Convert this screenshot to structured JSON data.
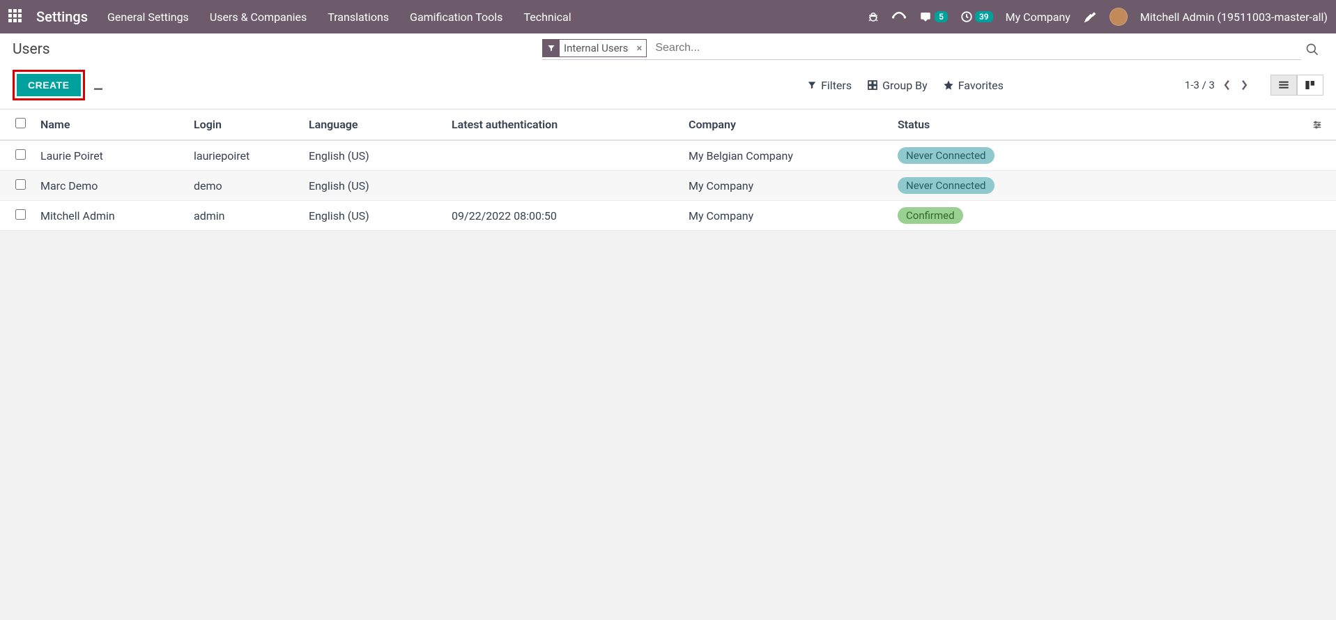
{
  "topbar": {
    "app_title": "Settings",
    "menu": [
      "General Settings",
      "Users & Companies",
      "Translations",
      "Gamification Tools",
      "Technical"
    ],
    "messages_badge": "5",
    "activities_badge": "39",
    "company": "My Company",
    "user": "Mitchell Admin (19511003-master-all)"
  },
  "control": {
    "page_title": "Users",
    "search_facet": "Internal Users",
    "search_placeholder": "Search...",
    "create_label": "CREATE",
    "filters_label": "Filters",
    "groupby_label": "Group By",
    "favorites_label": "Favorites",
    "pager_text": "1-3 / 3"
  },
  "table": {
    "headers": {
      "name": "Name",
      "login": "Login",
      "language": "Language",
      "latest_auth": "Latest authentication",
      "company": "Company",
      "status": "Status"
    },
    "rows": [
      {
        "name": "Laurie Poiret",
        "login": "lauriepoiret",
        "language": "English (US)",
        "latest_auth": "",
        "company": "My Belgian Company",
        "status": "Never Connected",
        "status_class": "status-never"
      },
      {
        "name": "Marc Demo",
        "login": "demo",
        "language": "English (US)",
        "latest_auth": "",
        "company": "My Company",
        "status": "Never Connected",
        "status_class": "status-never"
      },
      {
        "name": "Mitchell Admin",
        "login": "admin",
        "language": "English (US)",
        "latest_auth": "09/22/2022 08:00:50",
        "company": "My Company",
        "status": "Confirmed",
        "status_class": "status-confirmed"
      }
    ]
  }
}
